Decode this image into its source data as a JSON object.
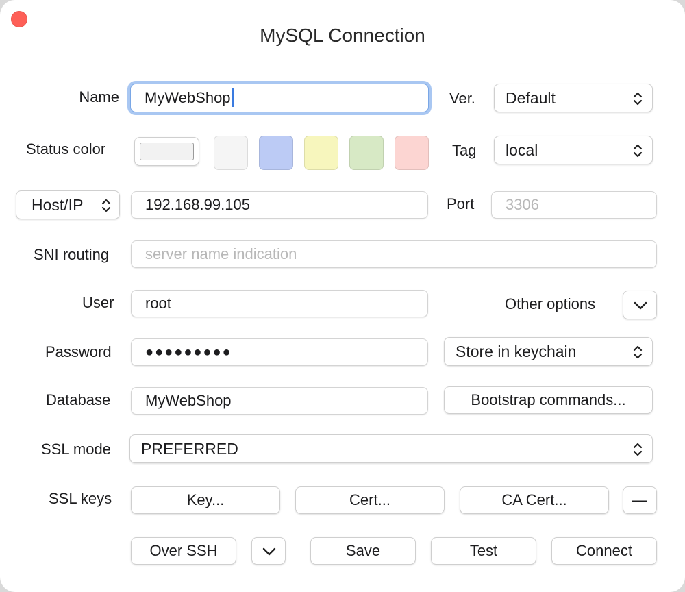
{
  "window": {
    "title": "MySQL Connection"
  },
  "form": {
    "name": {
      "label": "Name",
      "value": "MyWebShop"
    },
    "version": {
      "label": "Ver.",
      "selected": "Default"
    },
    "status_color": {
      "label": "Status color",
      "current": "#f2f2f2",
      "swatches": [
        "#f5f5f5",
        "#bccbf5",
        "#f7f6bd",
        "#d7e9c5",
        "#fcd5d2"
      ]
    },
    "tag": {
      "label": "Tag",
      "selected": "local"
    },
    "host": {
      "mode": "Host/IP",
      "value": "192.168.99.105"
    },
    "port": {
      "label": "Port",
      "placeholder": "3306"
    },
    "sni": {
      "label": "SNI routing",
      "placeholder": "server name indication"
    },
    "user": {
      "label": "User",
      "value": "root"
    },
    "other_options": {
      "label": "Other options"
    },
    "password": {
      "label": "Password",
      "value": "●●●●●●●●●",
      "storage": "Store in keychain"
    },
    "database": {
      "label": "Database",
      "value": "MyWebShop"
    },
    "bootstrap": {
      "label": "Bootstrap commands..."
    },
    "ssl_mode": {
      "label": "SSL mode",
      "selected": "PREFERRED"
    },
    "ssl_keys": {
      "label": "SSL keys",
      "key": "Key...",
      "cert": "Cert...",
      "ca_cert": "CA Cert...",
      "remove": "—"
    }
  },
  "footer": {
    "over_ssh": "Over SSH",
    "save": "Save",
    "test": "Test",
    "connect": "Connect"
  },
  "colors": {
    "focus_ring": "#a9c7f2",
    "caret": "#3a7be0",
    "close": "#fe5f57"
  }
}
